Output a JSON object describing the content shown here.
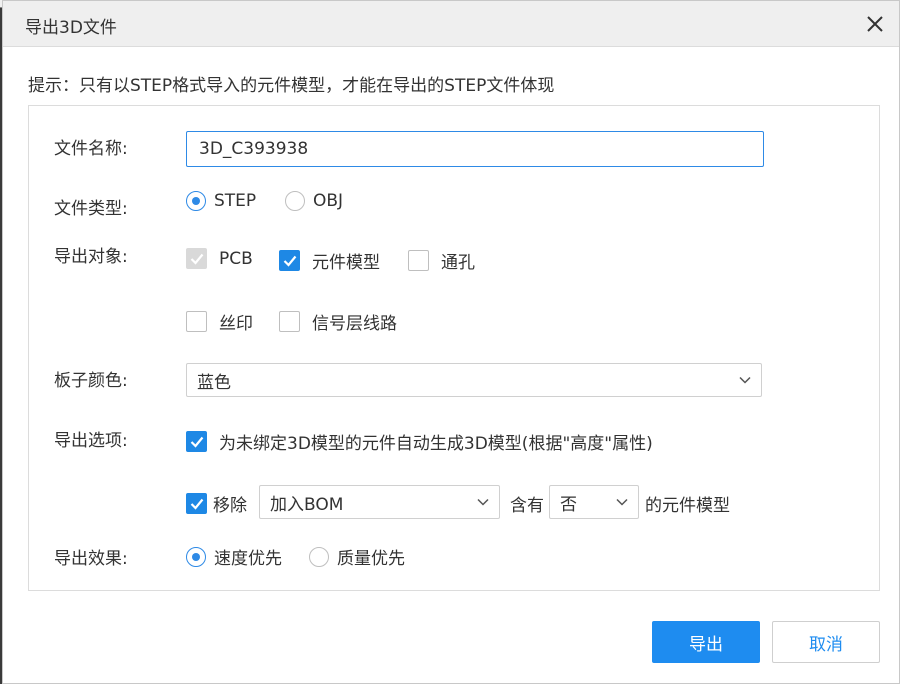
{
  "dialog": {
    "title": "导出3D文件",
    "tip": "提示：只有以STEP格式导入的元件模型，才能在导出的STEP文件体现"
  },
  "form": {
    "filename": {
      "label": "文件名称:",
      "value": "3D_C393938"
    },
    "filetype": {
      "label": "文件类型:",
      "options": [
        "STEP",
        "OBJ"
      ],
      "selected": "STEP"
    },
    "objects": {
      "label": "导出对象:",
      "items": [
        {
          "label": "PCB",
          "checked": true,
          "disabled": true
        },
        {
          "label": "元件模型",
          "checked": true
        },
        {
          "label": "通孔",
          "checked": false
        },
        {
          "label": "丝印",
          "checked": false
        },
        {
          "label": "信号层线路",
          "checked": false
        }
      ]
    },
    "board_color": {
      "label": "板子颜色:",
      "value": "蓝色"
    },
    "options": {
      "label": "导出选项:",
      "auto_generate": "为未绑定3D模型的元件自动生成3D模型(根据\"高度\"属性)",
      "remove_label": "移除",
      "remove_select": "加入BOM",
      "contains_label": "含有",
      "contains_select": "否",
      "suffix": "的元件模型"
    },
    "effect": {
      "label": "导出效果:",
      "options": [
        "速度优先",
        "质量优先"
      ],
      "selected": "速度优先"
    }
  },
  "buttons": {
    "export": "导出",
    "cancel": "取消"
  },
  "colors": {
    "accent": "#1e8cf0",
    "check": "#1e88e5",
    "border_focus": "#2e8ae6"
  },
  "icons": [
    "close-icon",
    "check-icon",
    "chevron-down-icon"
  ]
}
